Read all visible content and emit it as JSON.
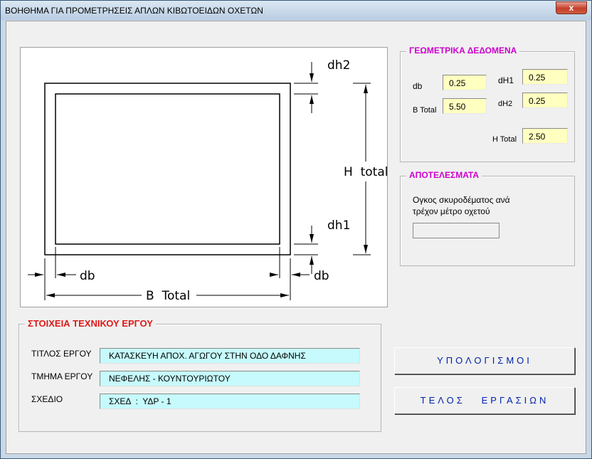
{
  "window": {
    "title": "ΒΟΗΘΗΜΑ ΓΙΑ ΠΡΟΜΕΤΡΗΣΕΙΣ ΑΠΛΩΝ ΚΙΒΩΤΟΕΙΔΩΝ ΟΧΕΤΩΝ",
    "close_label": "x"
  },
  "drawing": {
    "dh2": "dh2",
    "dh1": "dh1",
    "h_total": "H  total",
    "b_total": "B  Total",
    "db_left": "db",
    "db_right": "db"
  },
  "geometry": {
    "title": "ΓΕΩΜΕΤΡΙΚΑ ΔΕΔΟΜΕΝΑ",
    "db_label": "db",
    "db_value": "0.25",
    "btotal_label": "B Total",
    "btotal_value": "5.50",
    "dh1_label": "dH1",
    "dh1_value": "0.25",
    "dh2_label": "dH2",
    "dh2_value": "0.25",
    "htotal_label": "H Total",
    "htotal_value": "2.50"
  },
  "results": {
    "title": "ΑΠΟΤΕΛΕΣΜΑΤΑ",
    "line1": "Ογκος σκυροδέματος ανά",
    "line2": "τρέχον μέτρο οχετού",
    "value": ""
  },
  "project": {
    "title": "ΣΤΟΙΧΕΙΑ ΤΕΧΝΙΚΟΥ ΕΡΓΟΥ",
    "title_label": "ΤΙΤΛΟΣ ΕΡΓΟΥ",
    "title_value": "ΚΑΤΑΣΚΕΥΗ ΑΠΟΧ. ΑΓΩΓΟΥ ΣΤΗΝ ΟΔΟ ΔΑΦΝΗΣ",
    "section_label": "ΤΜΗΜΑ ΕΡΓΟΥ",
    "section_value": "ΝΕΦΕΛΗΣ - ΚΟΥΝΤΟΥΡΙΩΤΟΥ",
    "drawing_label": "ΣΧΕΔΙΟ",
    "drawing_value": "ΣΧΕΔ  :  ΥΔΡ - 1"
  },
  "buttons": {
    "calculate": "ΥΠΟΛΟΓΙΣΜΟΙ",
    "exit": "ΤΕΛΟΣ   ΕΡΓΑΣΙΩΝ"
  }
}
